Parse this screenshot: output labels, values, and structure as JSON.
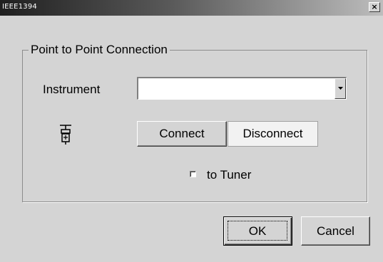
{
  "window": {
    "title": "IEEE1394",
    "close_label": "×"
  },
  "group": {
    "label": "Point to Point Connection"
  },
  "instrument": {
    "label": "Instrument",
    "value": ""
  },
  "buttons": {
    "connect": "Connect",
    "disconnect": "Disconnect",
    "ok": "OK",
    "cancel": "Cancel"
  },
  "tuner": {
    "label": "to Tuner",
    "checked": false
  },
  "icons": {
    "close": "close-icon",
    "dropdown": "chevron-down-icon",
    "plug": "plug-icon"
  },
  "colors": {
    "face": "#d4d4d4",
    "title_bar_start": "#202020",
    "title_bar_end": "#bdbdbd"
  }
}
